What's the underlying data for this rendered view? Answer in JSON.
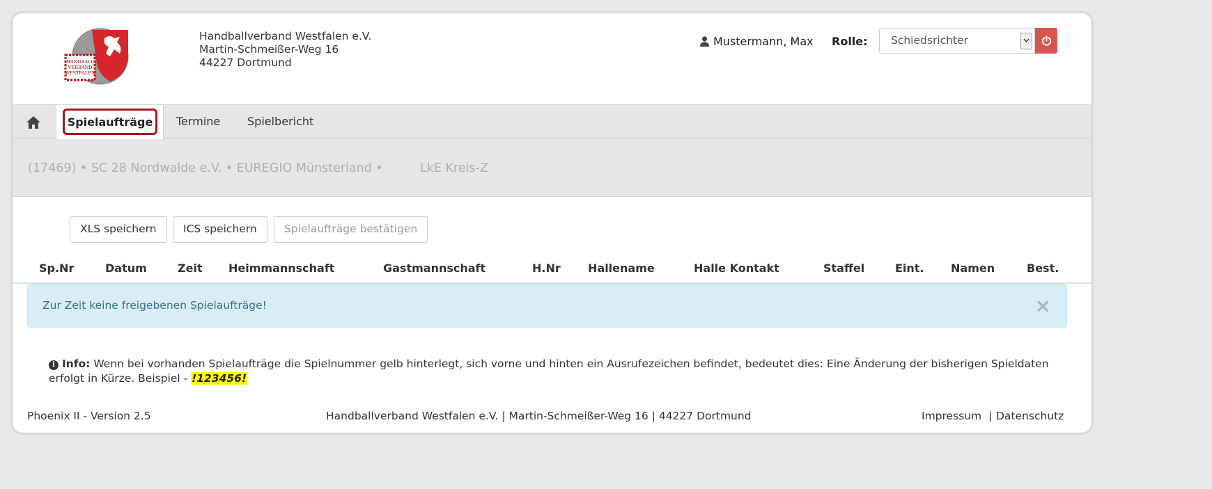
{
  "header": {
    "address_lines": [
      "Handballverband Westfalen e.V.",
      "Martin-Schmeißer-Weg 16",
      "44227 Dortmund"
    ],
    "logo_text": [
      "HANDBALL",
      "VERBAND",
      "WESTFALEN"
    ],
    "user_name": "Mustermann, Max",
    "role_label": "Rolle:",
    "role_selected": "Schiedsrichter"
  },
  "nav": {
    "tabs": [
      {
        "label": "Spielaufträge",
        "active": true
      },
      {
        "label": "Termine"
      },
      {
        "label": "Spielbericht"
      }
    ]
  },
  "subheader": {
    "parts": [
      "(17469) • SC 28 Nordwalde e.V. • EUREGIO Münsterland •",
      "LkE Kreis-Z"
    ]
  },
  "toolbar": {
    "xls_label": "XLS speichern",
    "ics_label": "ICS speichern",
    "confirm_label": "Spielaufträge bestätigen"
  },
  "table": {
    "columns": [
      "Sp.Nr",
      "Datum",
      "Zeit",
      "Heimmannschaft",
      "Gastmannschaft",
      "H.Nr",
      "Hallename",
      "Halle Kontakt",
      "Staffel",
      "Eint.",
      "Namen",
      "Best."
    ]
  },
  "alert": {
    "text": "Zur Zeit keine freigebenen Spielaufträge!",
    "close": "×"
  },
  "info": {
    "label": "Info:",
    "text1": "Wenn bei vorhanden Spielaufträge die Spielnummer gelb hinterlegt, sich vorne und hinten ein Ausrufezeichen befindet, bedeutet dies: Eine Änderung der bisherigen Spieldaten erfolgt in Kürze. Beispiel -",
    "example": "!123456!"
  },
  "footer": {
    "version": "Phoenix II - Version 2.5",
    "center": "Handballverband Westfalen e.V. | Martin-Schmeißer-Weg 16 | 44227 Dortmund",
    "impressum": "Impressum",
    "separator": "|",
    "datenschutz": "Datenschutz"
  },
  "colors": {
    "accent_red": "#d9534f",
    "active_tab_border": "#a4161a",
    "alert_bg": "#d9edf7",
    "alert_text": "#31708f",
    "highlight": "#ffff00"
  }
}
